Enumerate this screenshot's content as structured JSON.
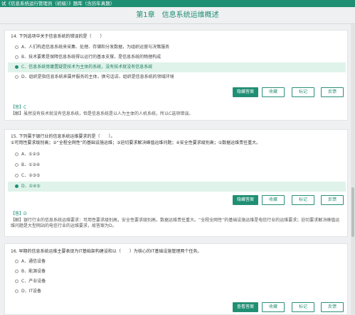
{
  "header": {
    "title": "试《信息系统运行管理员（初级）》题库（含历年真题）",
    "chapter": "第1章　信息系统运维概述"
  },
  "questions": [
    {
      "stem": "14. 下列选项中关于信息系统的错误的是（　　）",
      "options": [
        {
          "label": "A．人们构造信息系统来采集、处理、存储和分发数据，为组织运营与决策服务",
          "selected": false
        },
        {
          "label": "B．技术要素是保障信息系统得以运行的基本支撑，是信息系统的物理构成",
          "selected": false
        },
        {
          "label": "C．信息系统毋庸置疑是技术为主体的系统，没有技术就没有信息系统",
          "selected": true
        },
        {
          "label": "D．组织是指信息系统来属并服务的主体，换句话讲，组织是信息系统的领域环境",
          "selected": false
        }
      ],
      "buttons": [
        "隐藏答案",
        "收藏",
        "标记",
        "反馈"
      ],
      "answer_tag": "【答】C",
      "analysis": "【解】虽然没有技术就没有信息系统，但是信息系统是以人为主体的人机系统，所以C选项错误。"
    },
    {
      "stem": "15. 下列属于银行业的信息系统运维要求的是（　　）。",
      "stem2": "①可用性要求级别高；②“全程全网性”的基础设施运维；③迫切要求解决峰值运维问题；④安全性要求级别高；⑤数据运维责任重大。",
      "options": [
        {
          "label": "A．①②⑤",
          "selected": false
        },
        {
          "label": "B．①③④",
          "selected": false
        },
        {
          "label": "C．②③⑤",
          "selected": false
        },
        {
          "label": "D．①④⑤",
          "selected": true
        }
      ],
      "buttons": [
        "隐藏答案",
        "收藏",
        "标记",
        "反馈"
      ],
      "answer_tag": "【答】D",
      "analysis": "【解】银行行业的信息系统运维要求：可用性要求级别高，安全性要求级别高，数据运维责任重大。“全程全网性”的基础设施运维是电信行业的运维要求；迫切要求解决峰值运维问题是大型网站的电信行业的运维要求，故答案为D。"
    },
    {
      "stem": "16. 早期的信息系统运维主要表现为IT基础架构建设和以（　　）为核心的IT基础设施管理两个任务。",
      "options": [
        {
          "label": "A．通信设备",
          "selected": false
        },
        {
          "label": "B．能源设备",
          "selected": false
        },
        {
          "label": "C．产业设备",
          "selected": false
        },
        {
          "label": "D．IT设备",
          "selected": false
        }
      ],
      "buttons": [
        "查看答案",
        "收藏",
        "标记",
        "反馈"
      ]
    }
  ],
  "colors": {
    "accent": "#1f8f74",
    "selected_bg": "#dff3ea"
  }
}
